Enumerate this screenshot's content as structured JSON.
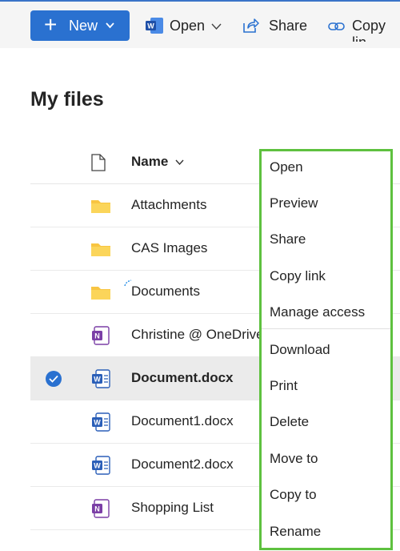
{
  "commandbar": {
    "new_label": "New",
    "open_label": "Open",
    "share_label": "Share",
    "copylink_label": "Copy lin"
  },
  "page": {
    "title": "My files"
  },
  "list": {
    "column_name": "Name",
    "rows": [
      {
        "name": "Attachments",
        "type": "folder",
        "selected": false
      },
      {
        "name": "CAS Images",
        "type": "folder",
        "selected": false
      },
      {
        "name": "Documents",
        "type": "folder",
        "selected": false
      },
      {
        "name": "Christine @ OneDrive",
        "type": "onenote",
        "selected": false
      },
      {
        "name": "Document.docx",
        "type": "word",
        "selected": true
      },
      {
        "name": "Document1.docx",
        "type": "word",
        "selected": false
      },
      {
        "name": "Document2.docx",
        "type": "word",
        "selected": false
      },
      {
        "name": "Shopping List",
        "type": "onenote",
        "selected": false
      }
    ]
  },
  "context_menu": {
    "items": [
      "Open",
      "Preview",
      "Share",
      "Copy link",
      "Manage access",
      "Download",
      "Print",
      "Delete",
      "Move to",
      "Copy to",
      "Rename"
    ]
  },
  "colors": {
    "accent": "#2a71d0",
    "menu_highlight_border": "#5ec13f",
    "folder": "#f8c542",
    "onenote": "#7b3fa6",
    "word": "#2b5fb8"
  },
  "icons": [
    "plus-icon",
    "chevron-down-icon",
    "word-icon",
    "share-icon",
    "link-icon",
    "document-icon",
    "folder-icon",
    "onenote-icon",
    "checkmark-icon",
    "sync-icon"
  ]
}
